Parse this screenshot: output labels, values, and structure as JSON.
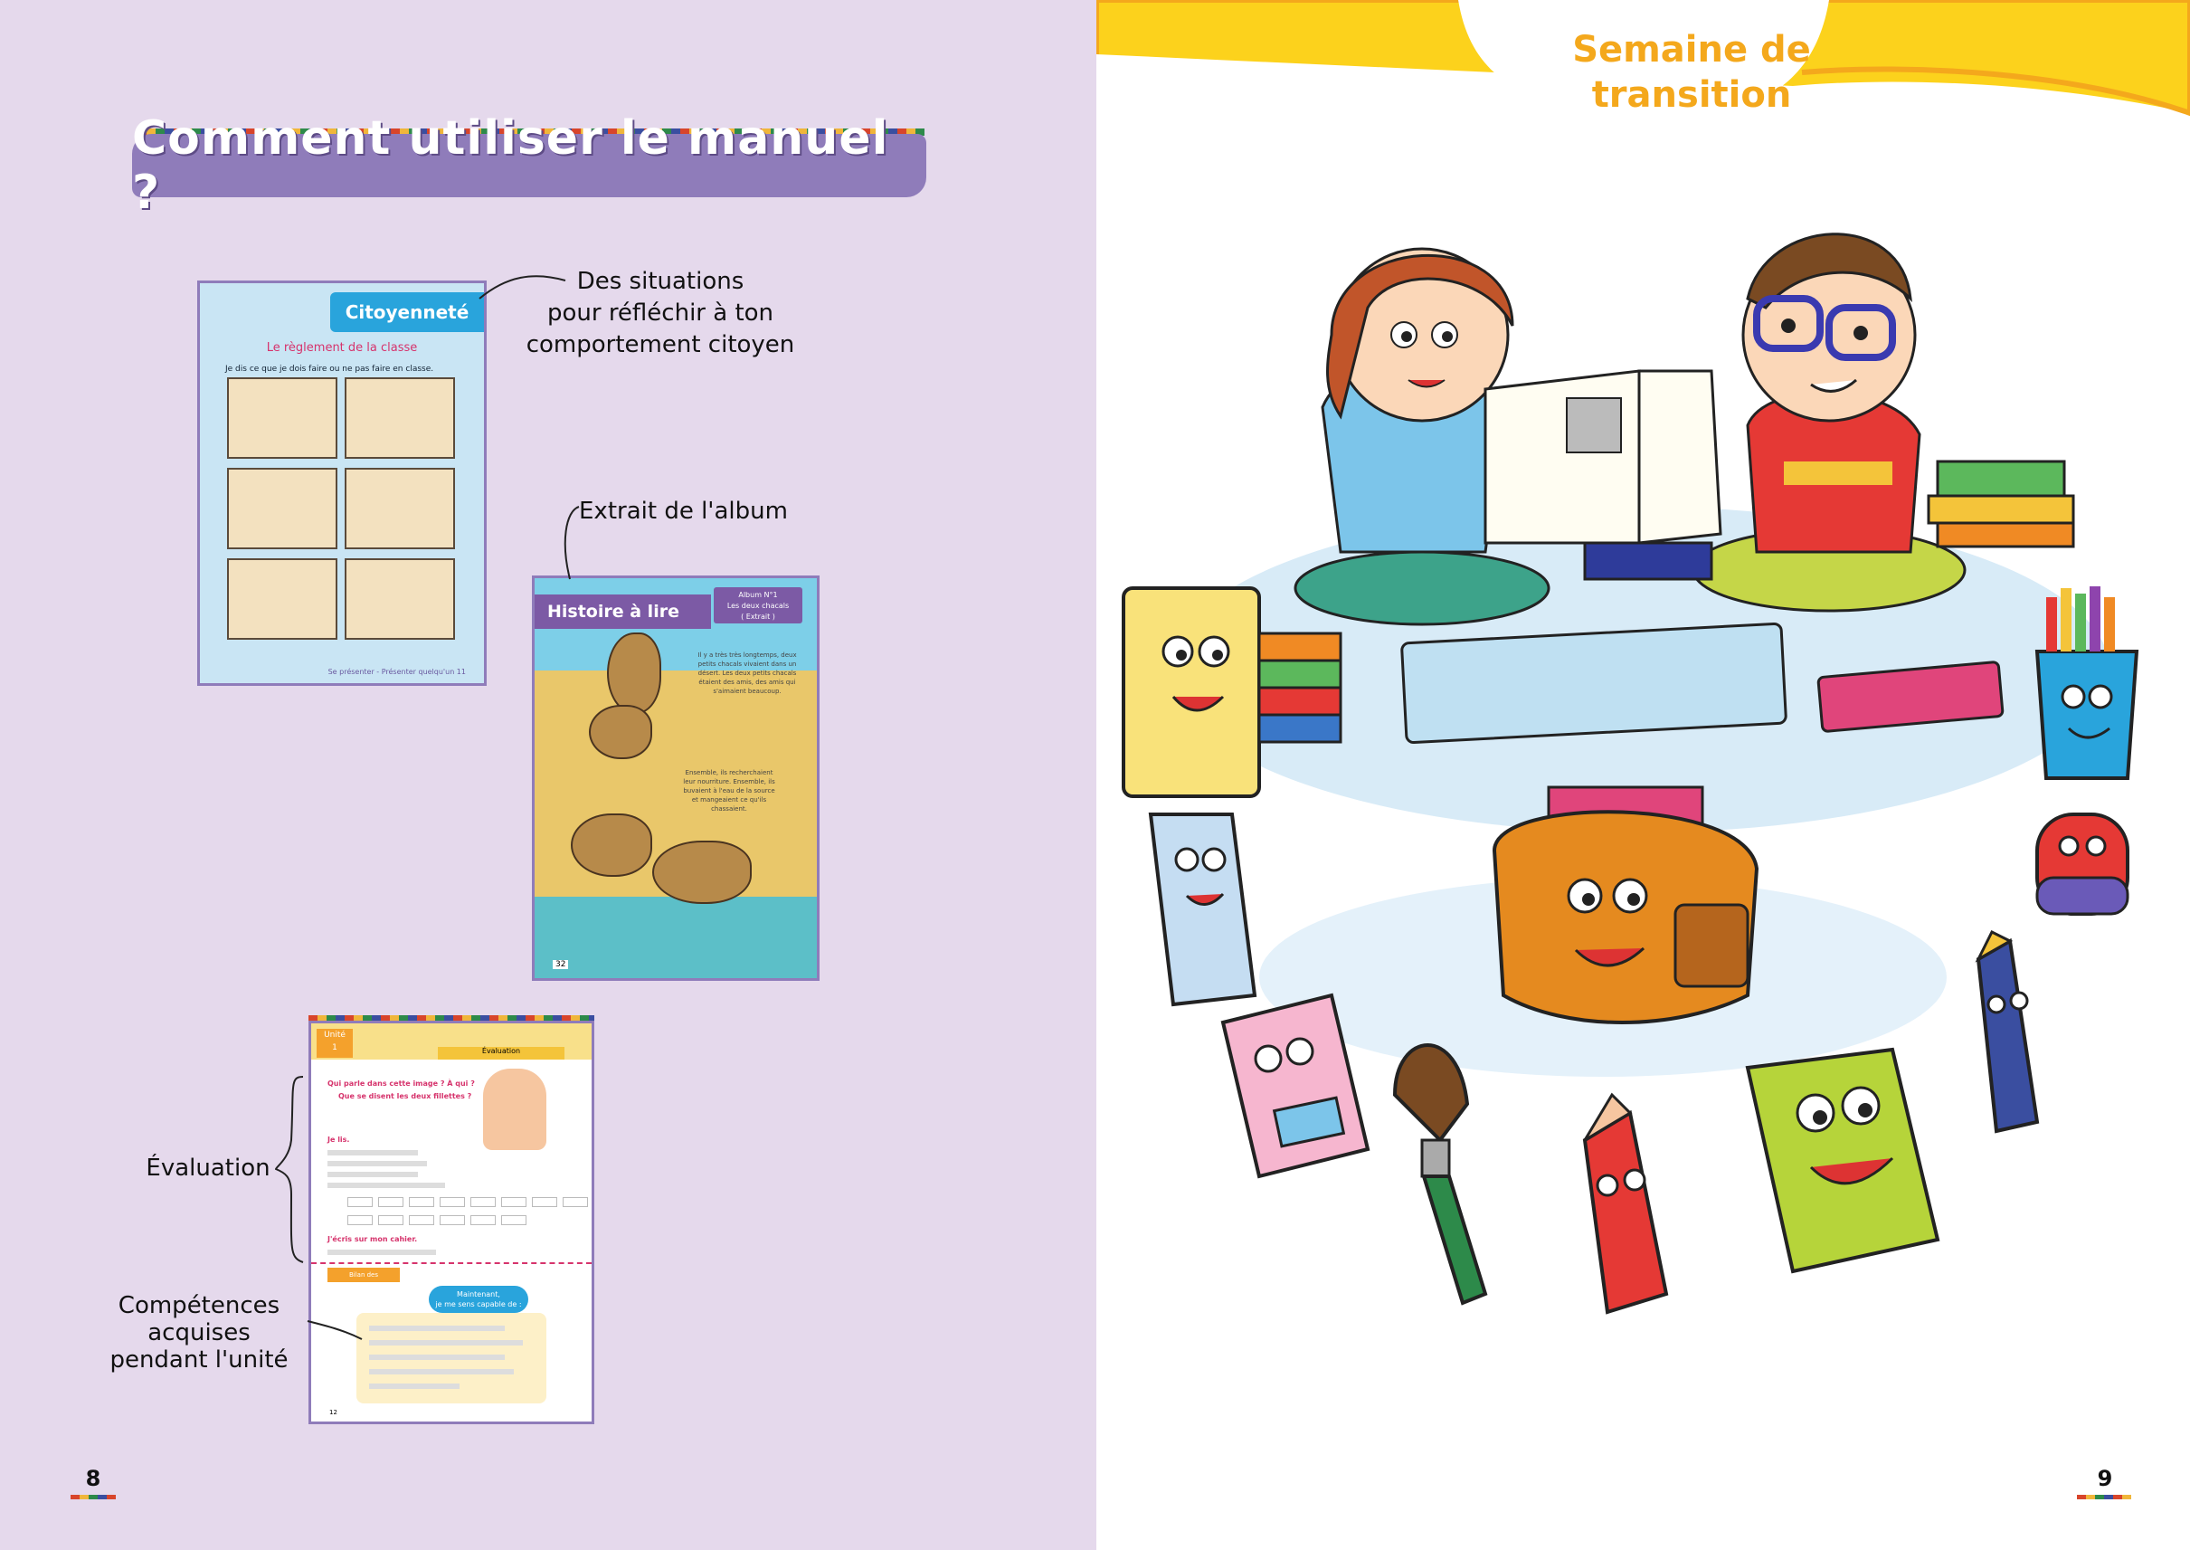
{
  "left_page": {
    "title": "Comment utiliser le manuel ?",
    "page_number": "8",
    "callouts": {
      "citizen": [
        "Des situations",
        "pour réfléchir à ton",
        "comportement citoyen"
      ],
      "album": "Extrait de l'album",
      "evaluation": "Évaluation",
      "skills": [
        "Compétences",
        "acquises",
        "pendant l'unité"
      ]
    },
    "thumb_citizen": {
      "tab": "Citoyenneté",
      "subtitle": "Le règlement de la classe",
      "instruction": "Je dis ce que je dois faire ou ne pas faire en classe.",
      "footer": "Se présenter - Présenter quelqu'un   11"
    },
    "thumb_story": {
      "tab": "Histoire à lire",
      "album_box": [
        "Album N°1",
        "Les deux chacals",
        "( Extrait )"
      ],
      "text1": "Il y a très très longtemps, deux petits chacals vivaient dans un désert. Les deux petits chacals étaient des amis, des amis qui s'aimaient beaucoup.",
      "text2": "Ensemble, ils recherchaient leur nourriture. Ensemble, ils buvaient à l'eau de la source et mangeaient ce qu'ils chassaient.",
      "page": "32"
    },
    "thumb_eval": {
      "unit": [
        "Unité",
        "1"
      ],
      "label": "Évaluation",
      "q1": "Qui parle dans cette image ? À qui ?",
      "q1b": "Que se disent les deux fillettes ?",
      "q2": "Je lis.",
      "q3": "J'écris sur mon cahier.",
      "bilan": "Bilan des apprentissages",
      "cloud": [
        "Maintenant,",
        "je me sens capable de :"
      ],
      "page": "12"
    }
  },
  "right_page": {
    "unit_title": [
      "Semaine de",
      "transition"
    ],
    "page_number": "9"
  },
  "colors": {
    "left_bg": "#e5d9ec",
    "banner": "#8f7cba",
    "accent_yellow": "#f4a81c",
    "band_yellow": "#fcd21c"
  }
}
